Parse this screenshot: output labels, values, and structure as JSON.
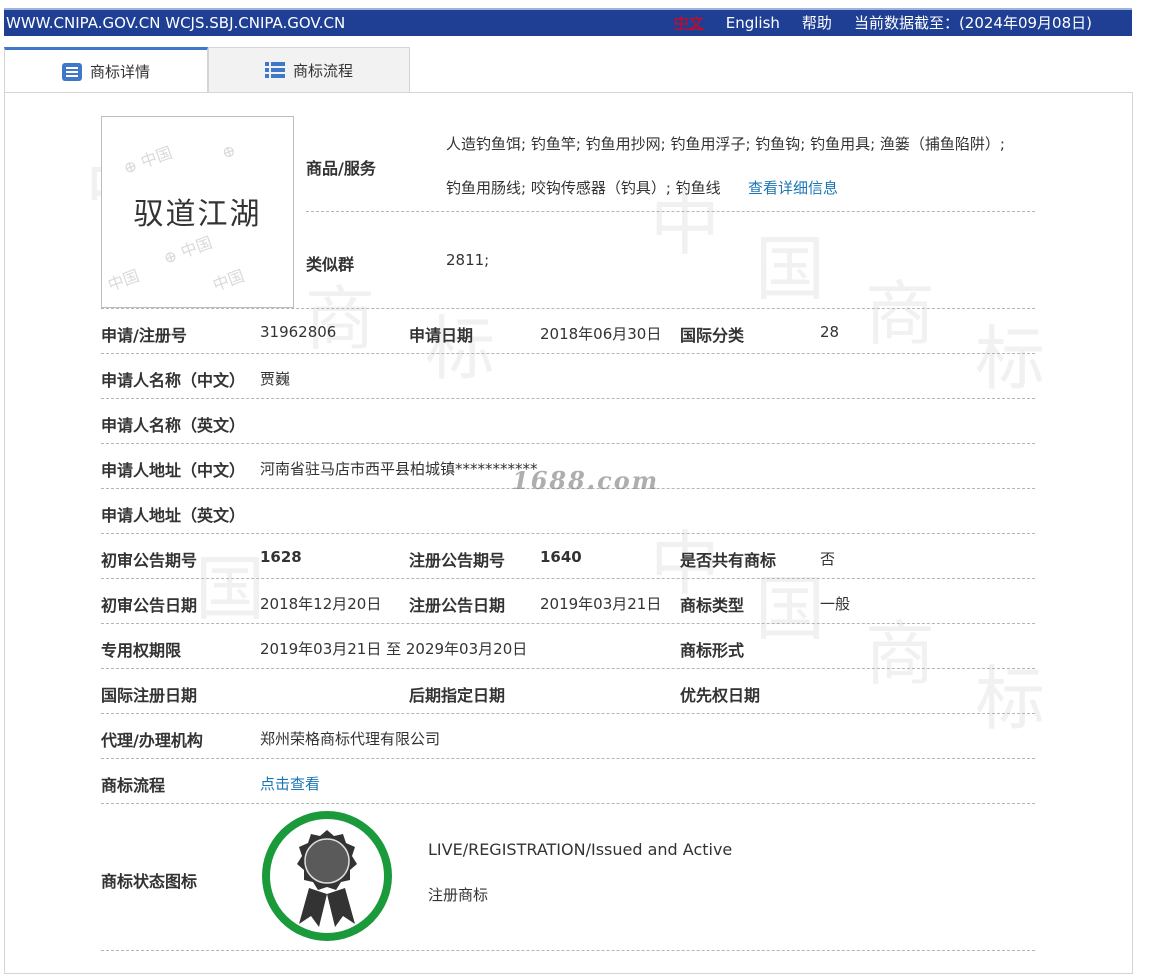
{
  "topbar": {
    "sites": "WWW.CNIPA.GOV.CN WCJS.SBJ.CNIPA.GOV.CN",
    "lang_cn": "中文",
    "lang_en": "English",
    "help": "帮助",
    "data_date": "当前数据截至：(2024年09月08日)"
  },
  "tabs": [
    {
      "label": "商标详情",
      "icon": "list-icon"
    },
    {
      "label": "商标流程",
      "icon": "flow-list-icon"
    }
  ],
  "logo": {
    "text": "驭道江湖"
  },
  "goods": {
    "label": "商品/服务",
    "line1": "人造钓鱼饵; 钓鱼竿; 钓鱼用抄网; 钓鱼用浮子; 钓鱼钩; 钓鱼用具; 渔篓（捕鱼陷阱）;",
    "line2": "钓鱼用肠线; 咬钩传感器（钓具）; 钓鱼线",
    "detail_link": "查看详细信息"
  },
  "similar_group": {
    "label": "类似群",
    "value": "2811;"
  },
  "fields": {
    "reg_no_label": "申请/注册号",
    "reg_no": "31962806",
    "app_date_label": "申请日期",
    "app_date": "2018年06月30日",
    "intl_class_label": "国际分类",
    "intl_class": "28",
    "applicant_cn_label": "申请人名称（中文）",
    "applicant_cn": "贾巍",
    "applicant_en_label": "申请人名称（英文）",
    "applicant_en": "",
    "address_cn_label": "申请人地址（中文）",
    "address_cn": "河南省驻马店市西平县柏城镇***********",
    "address_en_label": "申请人地址（英文）",
    "address_en": "",
    "prelim_no_label": "初审公告期号",
    "prelim_no": "1628",
    "reg_pub_no_label": "注册公告期号",
    "reg_pub_no": "1640",
    "shared_label": "是否共有商标",
    "shared": "否",
    "prelim_date_label": "初审公告日期",
    "prelim_date": "2018年12月20日",
    "reg_pub_date_label": "注册公告日期",
    "reg_pub_date": "2019年03月21日",
    "tm_type_label": "商标类型",
    "tm_type": "一般",
    "exclusive_label": "专用权期限",
    "exclusive": "2019年03月21日 至 2029年03月20日",
    "tm_form_label": "商标形式",
    "tm_form": "",
    "intl_reg_date_label": "国际注册日期",
    "intl_reg_date": "",
    "later_date_label": "后期指定日期",
    "later_date": "",
    "priority_label": "优先权日期",
    "priority": "",
    "agent_label": "代理/办理机构",
    "agent": "郑州荣格商标代理有限公司",
    "flow_label": "商标流程",
    "flow_link": "点击查看",
    "status_icon_label": "商标状态图标",
    "status_en": "LIVE/REGISTRATION/Issued and Active",
    "status_cn": "注册商标"
  },
  "watermark": "1688.com",
  "colors": {
    "topbar": "#1f3f95",
    "link": "#1a76b5",
    "status_ring": "#1a9a3a",
    "active_tab_border": "#3f78c8"
  }
}
